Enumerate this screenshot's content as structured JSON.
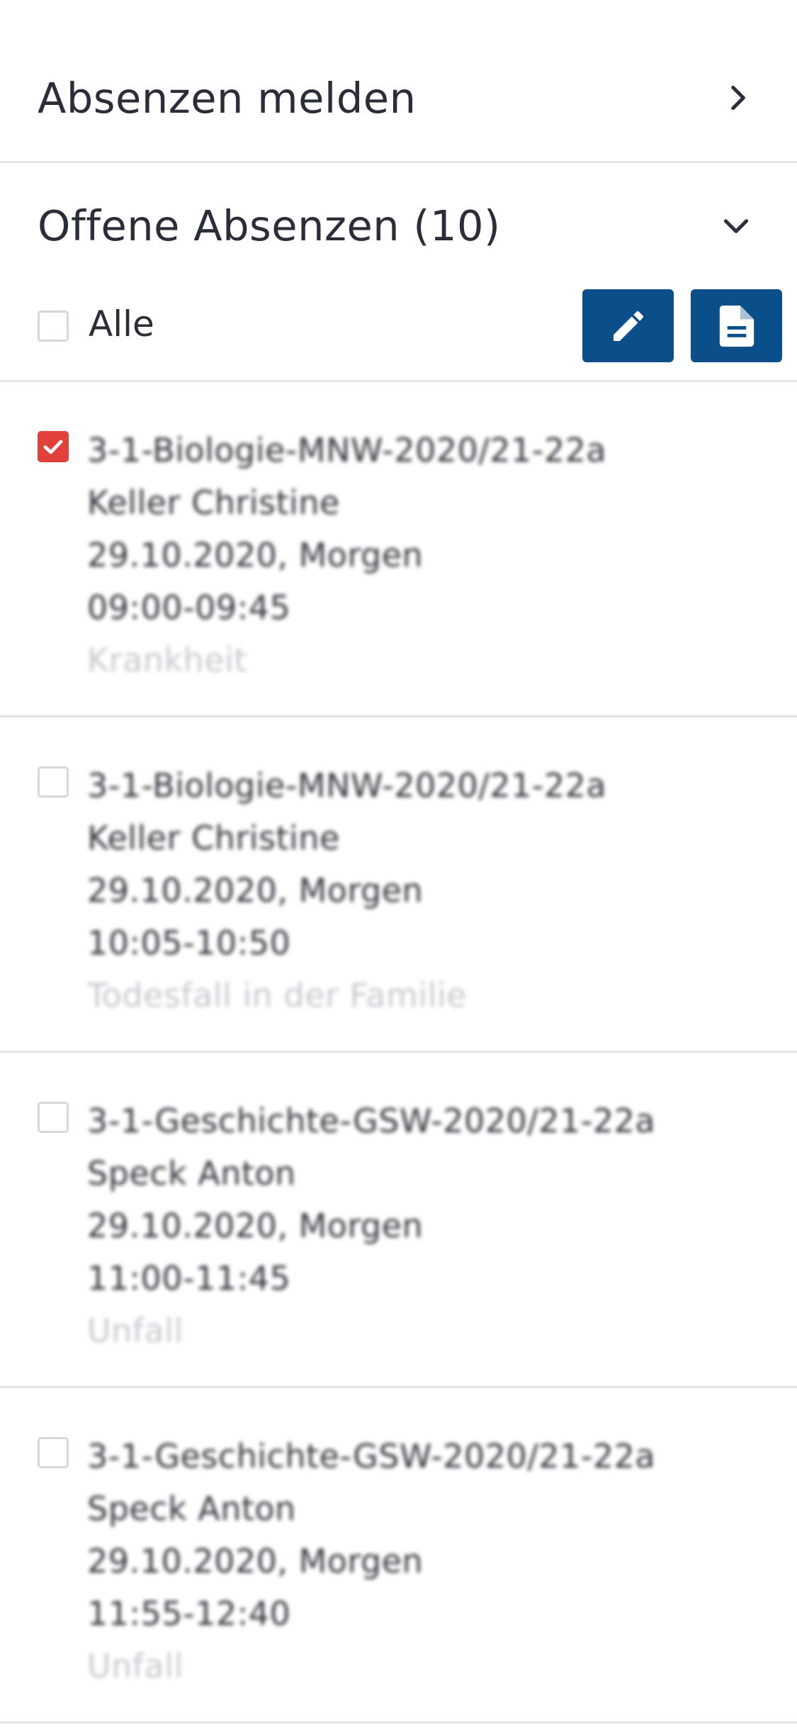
{
  "report_section": {
    "title": "Absenzen melden",
    "icon": "chevron-right-icon"
  },
  "open_section": {
    "title": "Offene Absenzen (10)",
    "icon": "chevron-down-icon",
    "select_all_label": "Alle",
    "actions": [
      {
        "name": "edit",
        "icon": "pencil-icon"
      },
      {
        "name": "document",
        "icon": "document-icon"
      }
    ]
  },
  "items": [
    {
      "checked": true,
      "course": "3-1-Biologie-MNW-2020/21-22a",
      "teacher": "Keller Christine",
      "date": "29.10.2020, Morgen",
      "time": "09:00-09:45",
      "reason": "Krankheit"
    },
    {
      "checked": false,
      "course": "3-1-Biologie-MNW-2020/21-22a",
      "teacher": "Keller Christine",
      "date": "29.10.2020, Morgen",
      "time": "10:05-10:50",
      "reason": "Todesfall in der Familie"
    },
    {
      "checked": false,
      "course": "3-1-Geschichte-GSW-2020/21-22a",
      "teacher": "Speck Anton",
      "date": "29.10.2020, Morgen",
      "time": "11:00-11:45",
      "reason": "Unfall"
    },
    {
      "checked": false,
      "course": "3-1-Geschichte-GSW-2020/21-22a",
      "teacher": "Speck Anton",
      "date": "29.10.2020, Morgen",
      "time": "11:55-12:40",
      "reason": "Unfall"
    }
  ],
  "colors": {
    "accent": "#0b4f8a",
    "checked": "#e2403a",
    "divider": "#e4e5e8",
    "text": "#2b2e38",
    "reason_text": "#c7c9d0"
  }
}
